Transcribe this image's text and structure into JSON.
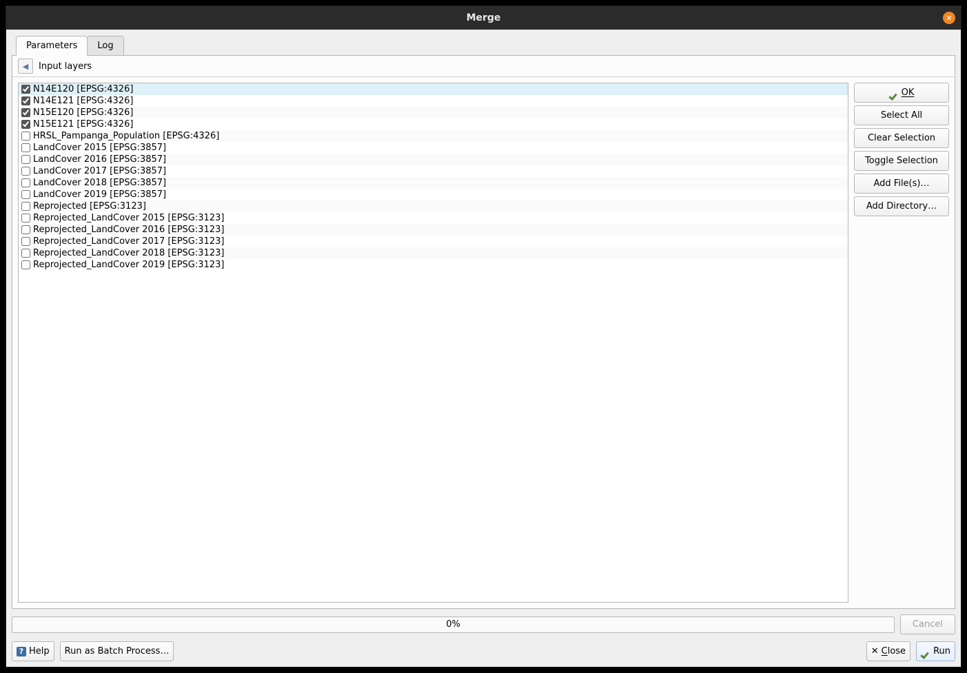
{
  "window": {
    "title": "Merge"
  },
  "tabs": {
    "parameters": "Parameters",
    "log": "Log",
    "active": "parameters"
  },
  "subheader": {
    "label": "Input layers"
  },
  "layers": [
    {
      "label": "N14E120 [EPSG:4326]",
      "checked": true,
      "selected": true
    },
    {
      "label": "N14E121 [EPSG:4326]",
      "checked": true,
      "selected": false
    },
    {
      "label": "N15E120 [EPSG:4326]",
      "checked": true,
      "selected": false
    },
    {
      "label": "N15E121 [EPSG:4326]",
      "checked": true,
      "selected": false
    },
    {
      "label": "HRSL_Pampanga_Population [EPSG:4326]",
      "checked": false,
      "selected": false
    },
    {
      "label": "LandCover 2015 [EPSG:3857]",
      "checked": false,
      "selected": false
    },
    {
      "label": "LandCover 2016 [EPSG:3857]",
      "checked": false,
      "selected": false
    },
    {
      "label": "LandCover 2017 [EPSG:3857]",
      "checked": false,
      "selected": false
    },
    {
      "label": "LandCover 2018 [EPSG:3857]",
      "checked": false,
      "selected": false
    },
    {
      "label": "LandCover 2019 [EPSG:3857]",
      "checked": false,
      "selected": false
    },
    {
      "label": "Reprojected [EPSG:3123]",
      "checked": false,
      "selected": false
    },
    {
      "label": "Reprojected_LandCover 2015 [EPSG:3123]",
      "checked": false,
      "selected": false
    },
    {
      "label": "Reprojected_LandCover 2016 [EPSG:3123]",
      "checked": false,
      "selected": false
    },
    {
      "label": "Reprojected_LandCover 2017 [EPSG:3123]",
      "checked": false,
      "selected": false
    },
    {
      "label": "Reprojected_LandCover 2018 [EPSG:3123]",
      "checked": false,
      "selected": false
    },
    {
      "label": "Reprojected_LandCover 2019 [EPSG:3123]",
      "checked": false,
      "selected": false
    }
  ],
  "side": {
    "ok": "OK",
    "select_all": "Select All",
    "clear_selection": "Clear Selection",
    "toggle_selection": "Toggle Selection",
    "add_files": "Add File(s)…",
    "add_directory": "Add Directory…"
  },
  "progress": {
    "text": "0%"
  },
  "footer": {
    "help": "Help",
    "batch": "Run as Batch Process…",
    "close": "Close",
    "run": "Run",
    "cancel": "Cancel"
  }
}
